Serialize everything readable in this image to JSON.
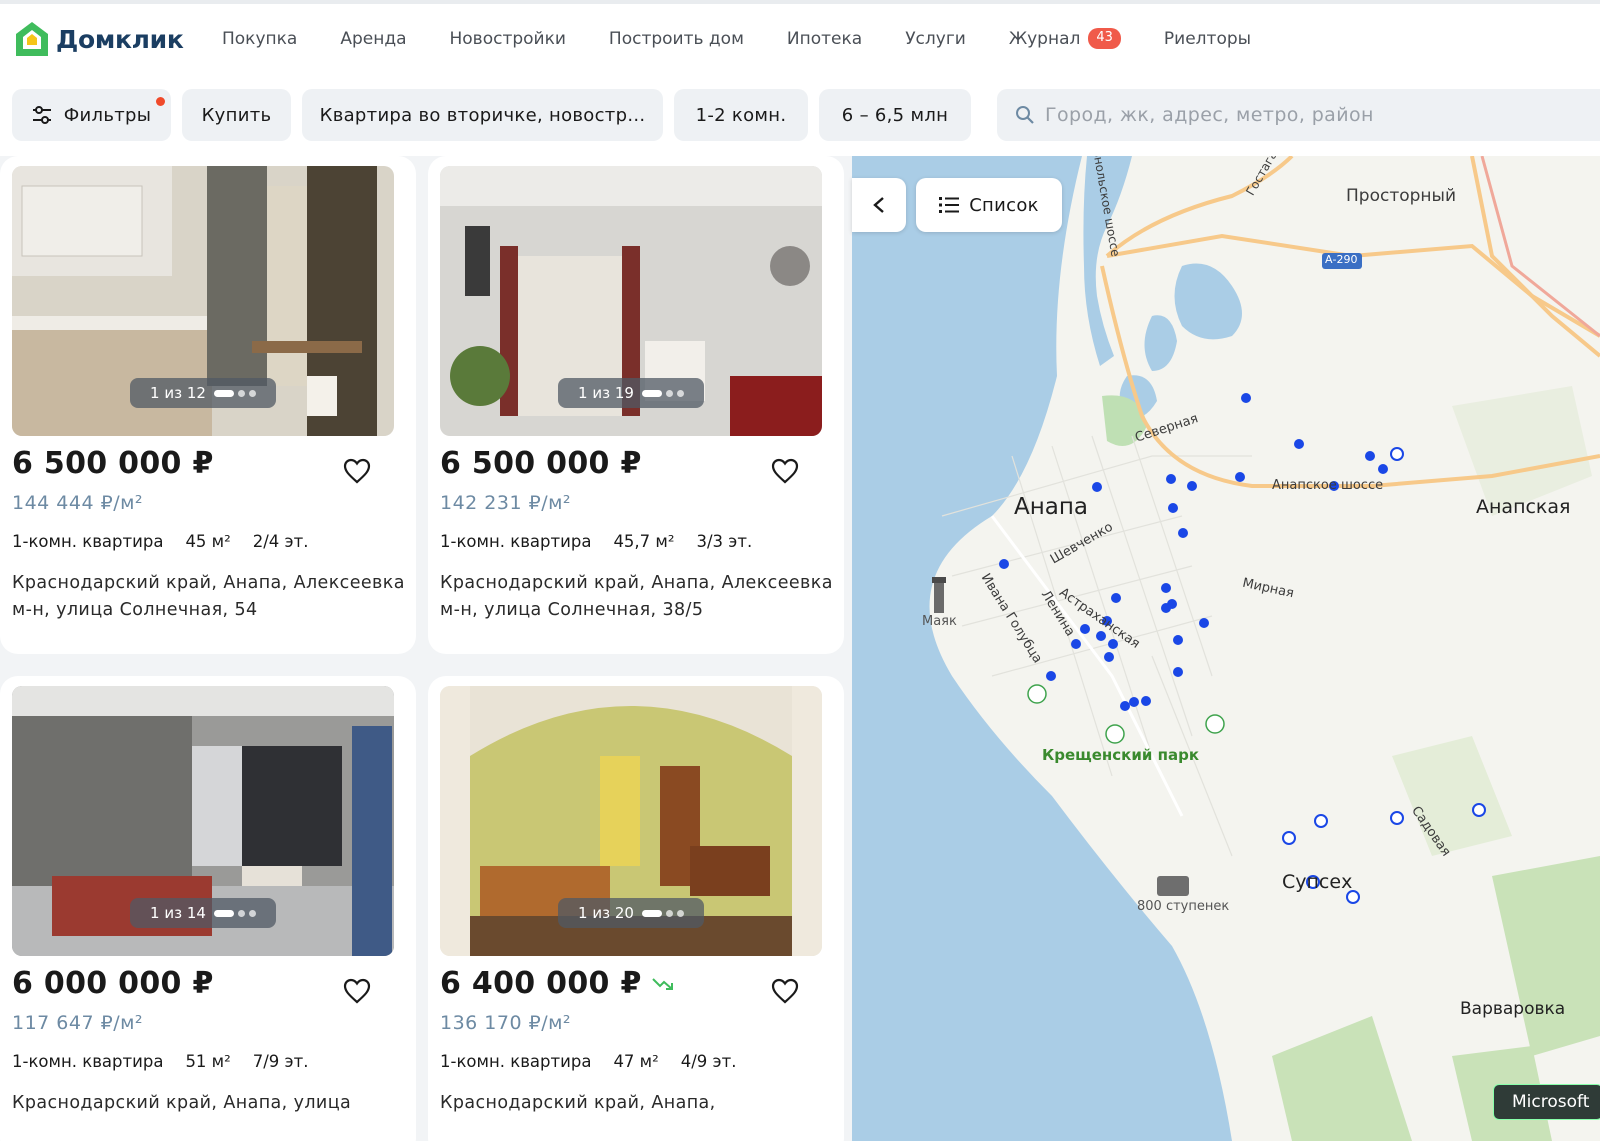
{
  "header": {
    "logo_text": "Домклик",
    "nav": [
      {
        "label": "Покупка"
      },
      {
        "label": "Аренда"
      },
      {
        "label": "Новостройки"
      },
      {
        "label": "Построить дом"
      },
      {
        "label": "Ипотека"
      },
      {
        "label": "Услуги"
      },
      {
        "label": "Журнал",
        "badge": "43"
      },
      {
        "label": "Риелторы"
      }
    ],
    "colors": {
      "brand_dark": "#1b3e62",
      "brand_green": "#3fbc5c",
      "badge": "#f05a4a"
    }
  },
  "filters": {
    "filters_label": "Фильтры",
    "deal": "Купить",
    "type": "Квартира во вторичке, новостр...",
    "rooms": "1-2 комн.",
    "price": "6 – 6,5 млн",
    "search_placeholder": "Город, жк, адрес, метро, район"
  },
  "listings": [
    {
      "counter": "1 из 12",
      "price": "6 500 000 ₽",
      "price_per_m2": "144 444 ₽/м²",
      "kind": "1-комн. квартира",
      "area": "45 м²",
      "floor": "2/4 эт.",
      "address": "Краснодарский край, Анапа, Алексеевка м-н, улица Солнечная, 54"
    },
    {
      "counter": "1 из 19",
      "price": "6 500 000 ₽",
      "price_per_m2": "142 231 ₽/м²",
      "kind": "1-комн. квартира",
      "area": "45,7 м²",
      "floor": "3/3 эт.",
      "address": "Краснодарский край, Анапа, Алексеевка м-н, улица Солнечная, 38/5"
    },
    {
      "counter": "1 из 14",
      "price": "6 000 000 ₽",
      "price_per_m2": "117 647 ₽/м²",
      "kind": "1-комн. квартира",
      "area": "51 м²",
      "floor": "7/9 эт.",
      "address": "Краснодарский край, Анапа, улица"
    },
    {
      "counter": "1 из 20",
      "price": "6 400 000 ₽",
      "price_per_m2": "136 170 ₽/м²",
      "kind": "1-комн. квартира",
      "area": "47 м²",
      "floor": "4/9 эт.",
      "address": "Краснодарский край, Анапа,",
      "price_dropped": true
    }
  ],
  "map": {
    "list_button": "Список",
    "labels": {
      "prostorny": "Просторный",
      "road_a290": "А-290",
      "anapa": "Анапа",
      "anapskaya": "Анапская",
      "mayak": "Маяк",
      "park": "Крещенский парк",
      "sukko": "Супсех",
      "steps": "800 ступенек",
      "varvarovka": "Варваровка",
      "severnaya": "Северная",
      "anapskoe_shosse": "Анапское шоссе",
      "shevchenko": "Шевченко",
      "mirnaya": "Мирная",
      "ivana_golubca": "Ивана Голубца",
      "lenina": "Ленина",
      "astrakhanskaya": "Астраханская",
      "sadovaya": "Садовая",
      "gostagaevskoe": "Гостага",
      "pionersky": "онольское шоссе"
    },
    "attribution": "Microsoft",
    "colors": {
      "sea": "#aacde6",
      "land": "#f4f4ef",
      "road": "#f7c98a",
      "marker": "#1a47e6"
    }
  }
}
